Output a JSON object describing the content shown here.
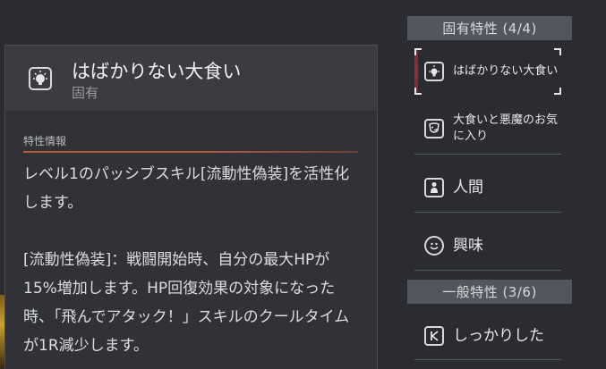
{
  "tooltip": {
    "title": "はばかりない大食い",
    "subtitle": "固有",
    "section_label": "特性情報",
    "desc_para1": "レベル1のパッシブスキル[流動性偽装]を活性化します。",
    "desc_para2": "[流動性偽装]：戦闘開始時、自分の最大HPが15%増加します。HP回復効果の対象になった時、「飛んでアタック！」スキルのクールタイムが1R減少します。",
    "icon": "lightbulb-icon"
  },
  "traits": {
    "unique_header": "固有特性 (4/4)",
    "general_header": "一般特性 (3/6)",
    "items": [
      {
        "label": "はばかりない大食い",
        "icon": "lightbulb-icon"
      },
      {
        "label": "大食いと悪魔のお気に入り",
        "icon": "mask-icon"
      },
      {
        "label": "人間",
        "icon": "person-icon"
      },
      {
        "label": "興味",
        "icon": "smiley-icon"
      },
      {
        "label": "しっかりした",
        "icon": "k-shield-icon"
      }
    ]
  },
  "colors": {
    "accent": "#b5583a",
    "panel": "#33353b",
    "background": "#2b2c31"
  }
}
